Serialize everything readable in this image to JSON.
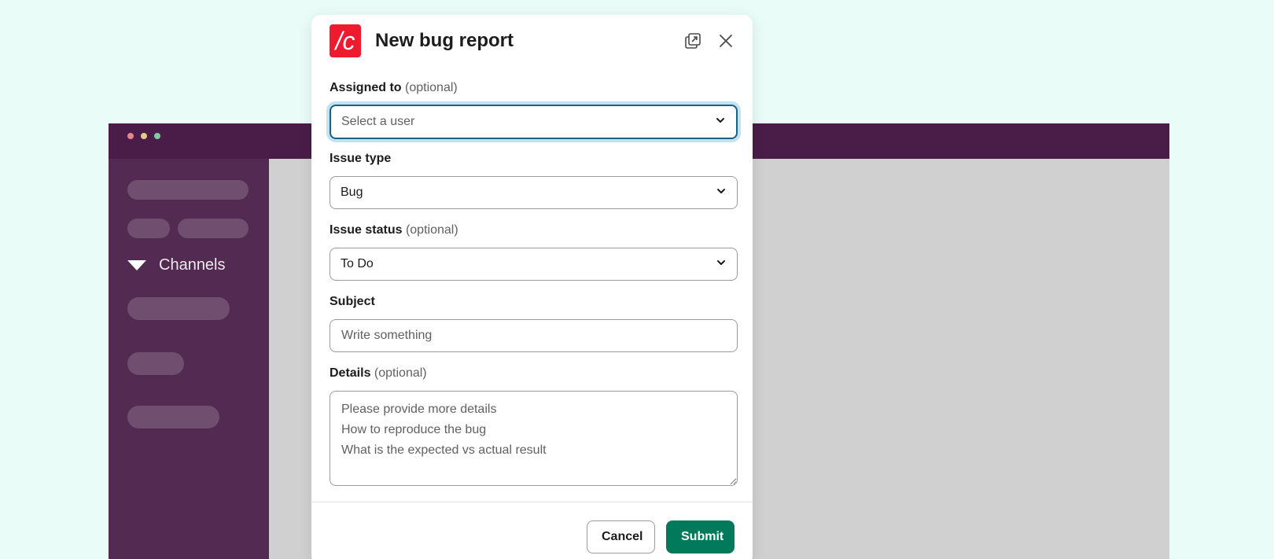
{
  "background_app": {
    "sidebar": {
      "channels_label": "Channels"
    },
    "colors": {
      "titlebar": "#4a1d48",
      "sidebar": "#532b52",
      "content": "#d0d0d0",
      "dot_red": "#e8848c",
      "dot_yellow": "#e3c98a",
      "dot_green": "#7fc9a4"
    }
  },
  "modal": {
    "logo_text": "/c",
    "title": "New bug report",
    "header_icons": [
      "popout-icon",
      "close-icon"
    ],
    "fields": {
      "assigned_to": {
        "label": "Assigned to",
        "optional": "(optional)",
        "placeholder": "Select a user"
      },
      "issue_type": {
        "label": "Issue type",
        "value": "Bug"
      },
      "issue_status": {
        "label": "Issue status",
        "optional": "(optional)",
        "value": "To Do"
      },
      "subject": {
        "label": "Subject",
        "placeholder": "Write something"
      },
      "details": {
        "label": "Details",
        "optional": "(optional)",
        "placeholder": "Please provide more details\nHow to reproduce the bug\nWhat is the expected vs actual result"
      }
    },
    "footer": {
      "cancel_label": "Cancel",
      "submit_label": "Submit"
    },
    "colors": {
      "logo": "#ee1b2e",
      "submit": "#007a5a",
      "focus_ring": "#1d9bd1"
    }
  }
}
